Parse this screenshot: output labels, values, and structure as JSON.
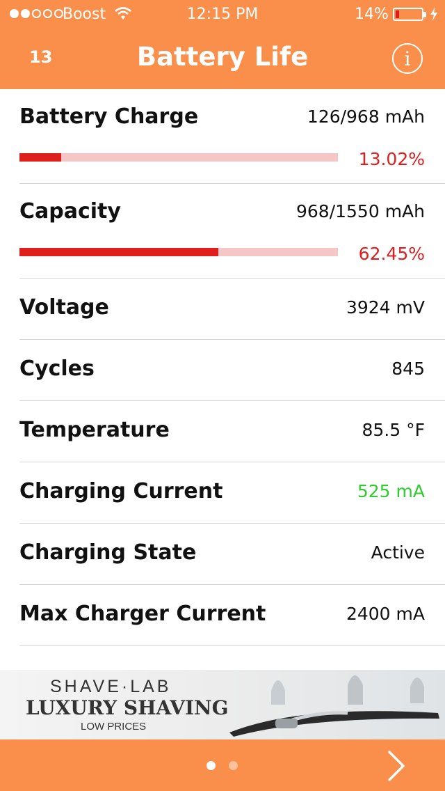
{
  "status_bar": {
    "carrier": "Boost",
    "time": "12:15 PM",
    "battery_percent": "14%",
    "battery_level": 0.14,
    "signal_bars_filled": 2,
    "signal_bars_total": 5
  },
  "nav": {
    "count": "13",
    "title": "Battery Life",
    "info_icon": "i"
  },
  "rows": {
    "battery_charge": {
      "label": "Battery Charge",
      "value": "126/968 mAh",
      "percent": "13.02%",
      "level": 0.1302
    },
    "capacity": {
      "label": "Capacity",
      "value": "968/1550 mAh",
      "percent": "62.45%",
      "level": 0.6245
    },
    "voltage": {
      "label": "Voltage",
      "value": "3924 mV"
    },
    "cycles": {
      "label": "Cycles",
      "value": "845"
    },
    "temperature": {
      "label": "Temperature",
      "value": "85.5 °F"
    },
    "charging_current": {
      "label": "Charging Current",
      "value": "525 mA"
    },
    "charging_state": {
      "label": "Charging State",
      "value": "Active"
    },
    "max_charger_current": {
      "label": "Max Charger Current",
      "value": "2400 mA"
    }
  },
  "ad": {
    "brand": "SHAVE·LAB",
    "headline": "LUXURY SHAVING",
    "sub": "LOW PRICES"
  },
  "pager": {
    "current": 1,
    "total": 2
  },
  "colors": {
    "accent": "#f98f4b",
    "bar_fill": "#df1e1e",
    "bar_track": "#f5c6c6",
    "positive": "#2fcc2f"
  },
  "icons": {
    "wifi": "wifi-icon",
    "battery": "battery-icon",
    "charging": "charging-bolt-icon",
    "info": "info-icon",
    "next": "chevron-right-icon"
  }
}
